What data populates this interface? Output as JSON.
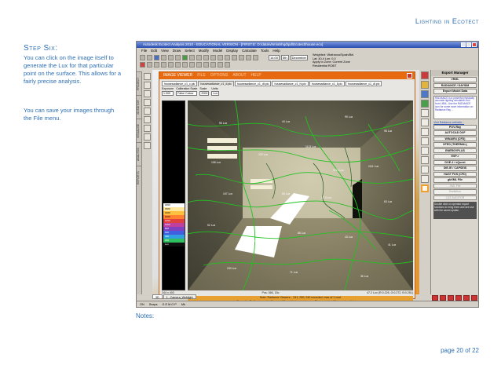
{
  "header": {
    "title": "Lighting in Ecotect"
  },
  "step": {
    "heading": "Step Six:",
    "paragraph1": "You can click on the image itself to generate the Lux for that particular point on the surface.  This allows for a fairly precise analysis.",
    "paragraph2": "You can save your images through the File menu."
  },
  "notes_label": "Notes:",
  "page_number": "page  20 of 22",
  "app": {
    "title": "Autodesk Ecotect Analysis 2010 - EDUCATIONAL VERSION - [FIRST.E: D:\\data\\vhm\\ahhqd\\pd\\Ecotect\\house.eco]",
    "menu": [
      "File",
      "Edit",
      "View",
      "Draw",
      "Select",
      "Modify",
      "Model",
      "Display",
      "Calculate",
      "Tools",
      "Help"
    ],
    "toolbar": {
      "time": "14:00",
      "date": "5th",
      "month": "December"
    },
    "status_info": [
      "Weighted: Vilafranca/Spain/Bel.",
      "Lat: 40.4  Lon: 0.0",
      "Apply to Zone: Current Zone",
      "Residential   ROBT"
    ],
    "rail_tabs": [
      "PROJECT",
      "3D EDITOR",
      "VISUALISE",
      "ANALYSIS",
      "REPORTS"
    ],
    "bottom_tabs": [
      "3D",
      "1 - Camera_Weblight"
    ],
    "statusbar": [
      "ON",
      "Snaps",
      "G E M O P",
      "Mk"
    ]
  },
  "viewer": {
    "title": "IMAGE VIEWER",
    "menus": [
      "FILE",
      "OPTIONS",
      "ABOUT",
      "HELP"
    ],
    "tabs": [
      "housesadiance_c1_c.pic",
      "housesadiance_c1_d.pic",
      "housesadiance_c1_dt.pic",
      "housesadiance_c1_hi.pic",
      "housesadiance_c1_ll.pic",
      "housesadiance_c1_dl.pic"
    ],
    "controls": {
      "exposure_label": "Exposure",
      "exposure_value": "1.000",
      "calibration_label": "Calibration Scale",
      "calibration_value": "False Colour",
      "scale_label": "Scale",
      "scale_value": "2000",
      "units_label": "Units",
      "units_value": "Lux"
    },
    "status_left": "344 x 400",
    "status_mid": "Pos: 366, 15c",
    "status_right": "47.2 Lux (R:0.226, G:0.272, B:0.251)",
    "note_line1": "Note: Radiance Viewers... 241, 250, 240 recorded, max of 1 cont",
    "note_line2": "Some the Radiance cache files are different between viewers. Please, extend 3 seconds, click to save",
    "legend": [
      "2000",
      "1800",
      "1600",
      "1400",
      "1200",
      "1000",
      "800",
      "600",
      "400",
      "200",
      "Lux"
    ],
    "contour_labels": [
      "55 Lux",
      "44 Lux",
      "99 Lux",
      "98 Lux",
      "108 Lux",
      "120 Lux",
      "1113 Lux",
      "1171 Lux",
      "1111 Lux",
      "107 Lux",
      "60 Lux",
      "47.3 Lux",
      "63 Lux",
      "52 Lux",
      "45 Lux",
      "88 Lux",
      "43 Lux",
      "41 Lux",
      "230 Lux",
      "71 Lux",
      "36 Lux"
    ]
  },
  "export": {
    "header": "Export Manager",
    "buttons_top": [
      "VRML",
      "RADIANCE / DAYSIM"
    ],
    "model_data_btn": "Export Model Data",
    "description": "RADIANCE is a powerful physically accurate lighting simulation tool from LBNL. Use the RADIANCE icon for some more information on Radiance Ray ...",
    "link": "Visit Radiance website...",
    "buttons": [
      "POV-Ray",
      "AUTOCAD DXF",
      "WINAIR4 (CFD)",
      "NTED (THERMAL)",
      "ENERGYPLUS",
      "ESP-r",
      "DOE-2 / eQuest",
      "DIE-IE / CAPSEIS",
      "HAST FDS (CFD)",
      "gbXML File"
    ],
    "disabled": [
      "XML File",
      "Radiation",
      "CAT AUDITOR"
    ],
    "help": "Double click on operator export functions to bring them and see use with the saved update."
  },
  "colors": {
    "accent_blue": "#2e6fb4",
    "viewer_orange": "#e86a10",
    "contour_green": "#22c222",
    "highlight": "#f0a030"
  }
}
